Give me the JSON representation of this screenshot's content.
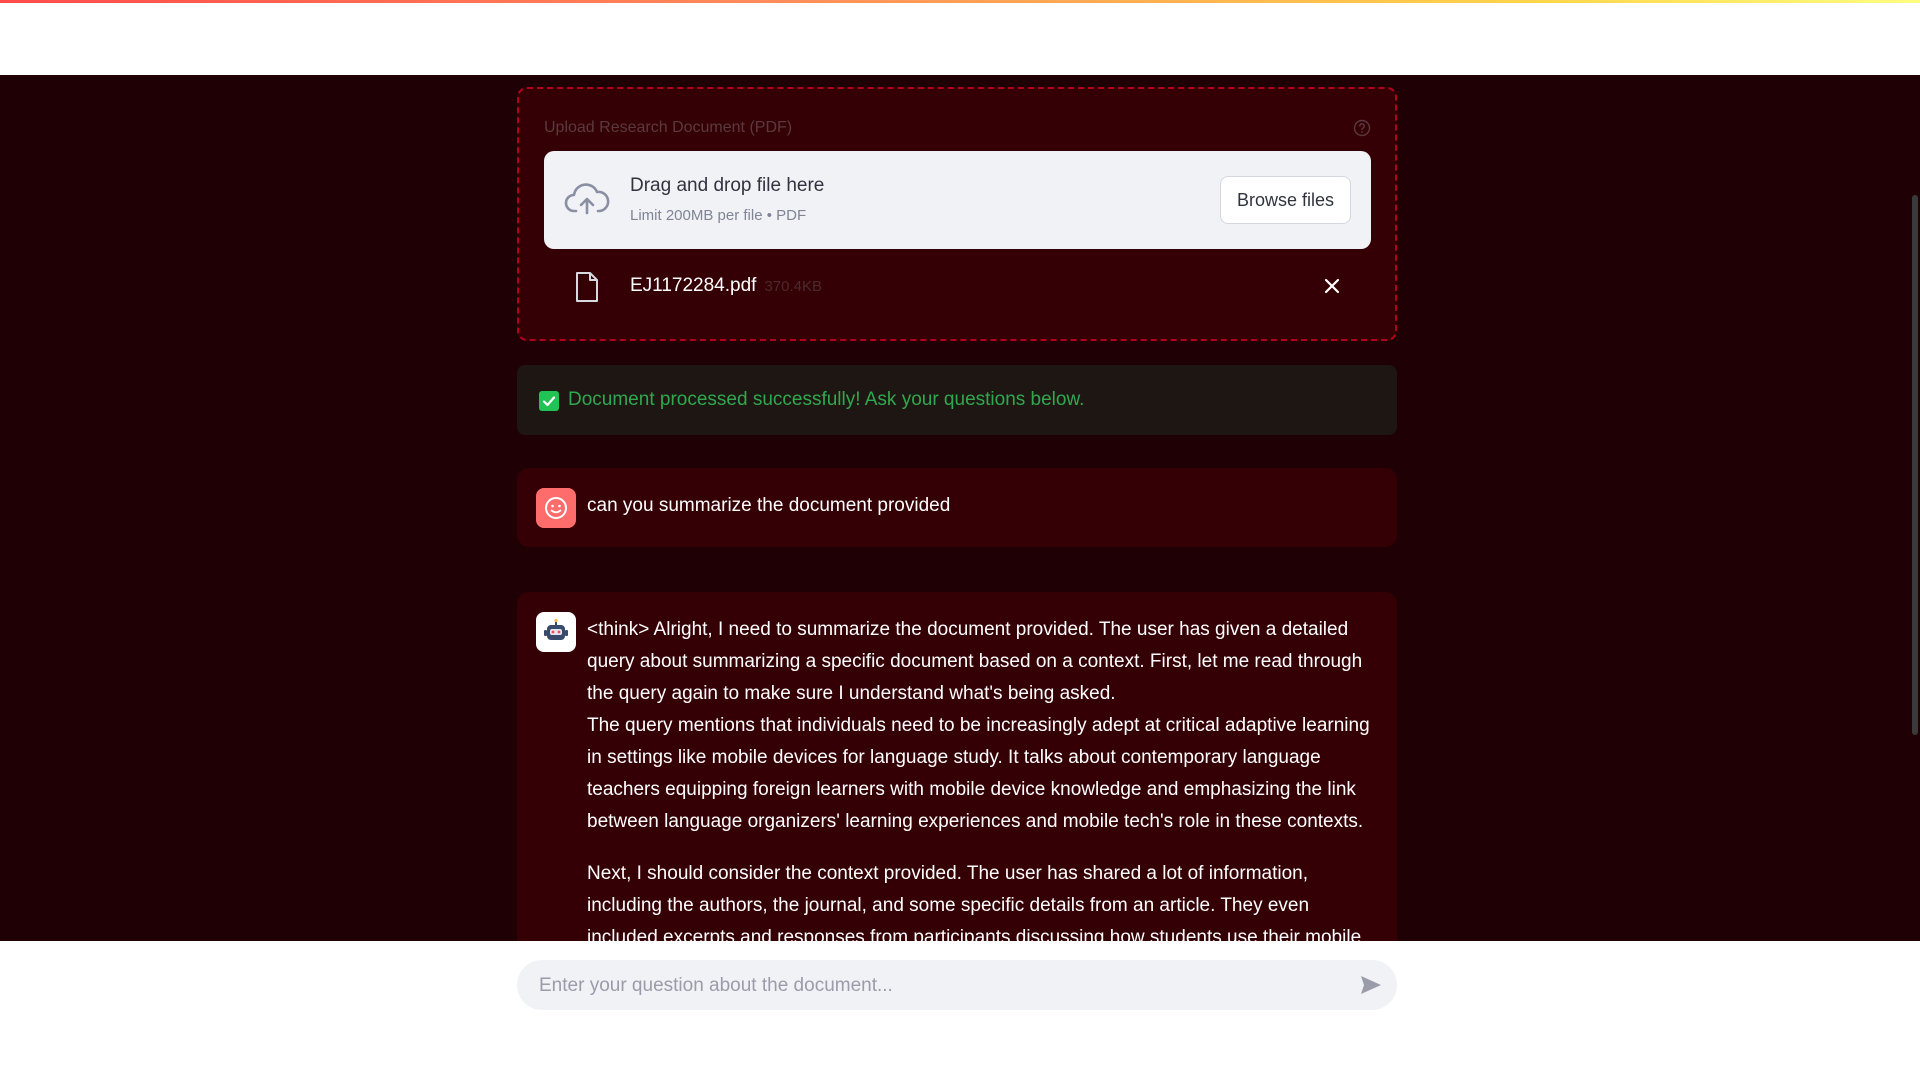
{
  "uploader": {
    "label": "Upload Research Document (PDF)",
    "drop_title": "Drag and drop file here",
    "drop_subtitle": "Limit 200MB per file • PDF",
    "browse_label": "Browse files",
    "file": {
      "name": "EJ1172284.pdf",
      "size": "370.4KB"
    }
  },
  "alert": {
    "text": "Document processed successfully! Ask your questions below."
  },
  "chat": {
    "user_message": "can you summarize the document provided",
    "assistant_paragraphs": [
      "<think> Alright, I need to summarize the document provided. The user has given a detailed query about summarizing a specific document based on a context. First, let me read through the query again to make sure I understand what's being asked.",
      "The query mentions that individuals need to be increasingly adept at critical adaptive learning in settings like mobile devices for language study. It talks about contemporary language teachers equipping foreign learners with mobile device knowledge and emphasizing the link between language organizers' learning experiences and mobile tech's role in these contexts.",
      "Next, I should consider the context provided. The user has shared a lot of information, including the authors, the journal, and some specific details from an article. They even included excerpts and responses from participants discussing how students use their mobile"
    ]
  },
  "input": {
    "placeholder": "Enter your question about the document..."
  },
  "colors": {
    "main_bg": "#1f0004",
    "card_bg": "#350005",
    "accent_red": "#ff4b4b",
    "success_green": "#2fa84f"
  },
  "icons": {
    "help": "help-circle-icon",
    "upload": "cloud-upload-icon",
    "file": "file-icon",
    "remove": "close-icon",
    "check": "check-icon",
    "send": "send-icon",
    "user_avatar": "user-avatar-icon",
    "assistant_avatar": "robot-avatar-icon"
  }
}
